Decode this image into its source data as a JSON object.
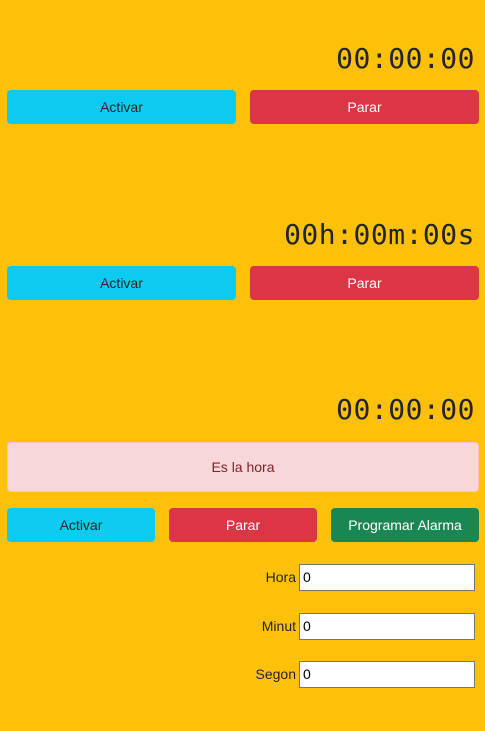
{
  "timer1": {
    "display": "00:00:00",
    "start_label": "Activar",
    "stop_label": "Parar"
  },
  "timer2": {
    "display": "00h:00m:00s",
    "start_label": "Activar",
    "stop_label": "Parar"
  },
  "alarm": {
    "display": "00:00:00",
    "alert_text": "Es la hora",
    "start_label": "Activar",
    "stop_label": "Parar",
    "set_alarm_label": "Programar Alarma",
    "fields": [
      {
        "label": "Hora",
        "value": "0"
      },
      {
        "label": "Minut",
        "value": "0"
      },
      {
        "label": "Segon",
        "value": "0"
      }
    ]
  },
  "colors": {
    "background": "#ffc107",
    "info": "#0dcaf0",
    "danger": "#dc3545",
    "success": "#198754",
    "alert_bg": "#f8d7da",
    "alert_text": "#842029"
  }
}
